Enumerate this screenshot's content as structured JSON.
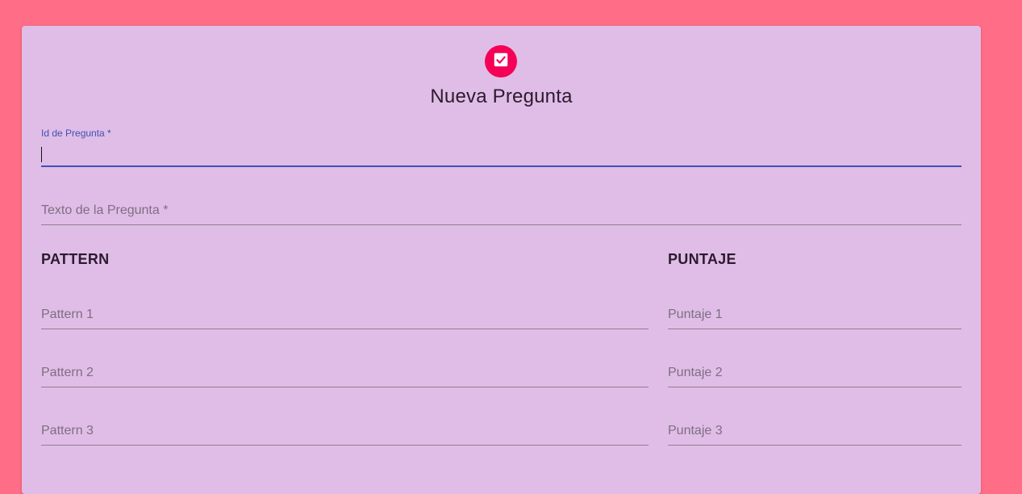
{
  "form": {
    "icon": "checkbox-checked-icon",
    "title": "Nueva Pregunta",
    "id_field": {
      "label": "Id de Pregunta *",
      "value": ""
    },
    "text_field": {
      "label": "Texto de la Pregunta *",
      "value": ""
    },
    "pattern_header": "PATTERN",
    "puntaje_header": "PUNTAJE",
    "patterns": [
      {
        "label": "Pattern 1"
      },
      {
        "label": "Pattern 2"
      },
      {
        "label": "Pattern 3"
      }
    ],
    "puntajes": [
      {
        "label": "Puntaje 1"
      },
      {
        "label": "Puntaje 2"
      },
      {
        "label": "Puntaje 3"
      }
    ]
  },
  "colors": {
    "background": "#ff6d87",
    "card": "#e0bde6",
    "avatar": "#f50057",
    "focus": "#3f51b5"
  }
}
